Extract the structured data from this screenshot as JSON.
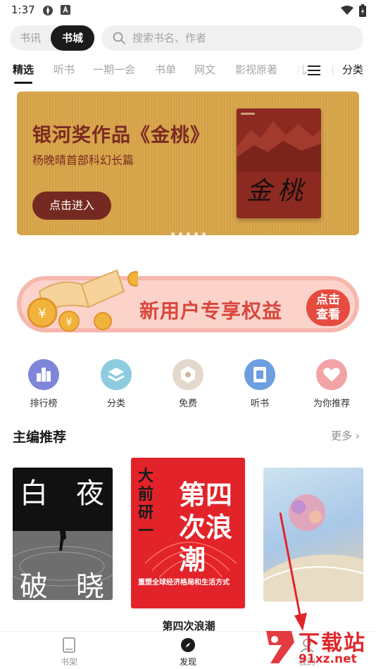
{
  "status_bar": {
    "time": "1:37"
  },
  "top": {
    "segments": [
      "书讯",
      "书城"
    ],
    "active_segment": "书城",
    "search_placeholder": "搜索书名、作者"
  },
  "tabs": [
    "精选",
    "听书",
    "一期一会",
    "书单",
    "网文",
    "影视原著",
    "儿"
  ],
  "active_tab": "精选",
  "category_link": "分类",
  "banner": {
    "title": "银河奖作品《金桃》",
    "subtitle": "杨晚晴首部科幻长篇",
    "button": "点击进入",
    "cover_text": "金桃",
    "page_count": 5,
    "colors": {
      "bg": "#d9a548",
      "accent": "#742a20"
    }
  },
  "promo": {
    "text": "新用户专享权益",
    "button_line1": "点击",
    "button_line2": "查看"
  },
  "quick_entries": [
    {
      "label": "排行榜",
      "icon": "ranking-icon"
    },
    {
      "label": "分类",
      "icon": "category-icon"
    },
    {
      "label": "免费",
      "icon": "free-icon"
    },
    {
      "label": "听书",
      "icon": "audiobook-icon"
    },
    {
      "label": "为你推荐",
      "icon": "heart-icon"
    }
  ],
  "section": {
    "title": "主编推荐",
    "more": "更多",
    "books": [
      {
        "cover_line1": "白",
        "cover_line2": "夜",
        "cover_line3": "破",
        "cover_line4": "晓"
      },
      {
        "author": "大前研一",
        "title_cover": "第四次浪潮",
        "tagline": "重塑全球经济格局和生活方式",
        "name": "第四次浪潮"
      },
      {
        "cover": "illustrated"
      }
    ]
  },
  "bottom_nav": [
    {
      "label": "书架",
      "icon": "bookshelf-icon"
    },
    {
      "label": "发现",
      "icon": "compass-icon"
    },
    {
      "label": "我的",
      "icon": "profile-icon"
    }
  ],
  "watermark": {
    "text": "下载站",
    "url": "91xz.net"
  }
}
